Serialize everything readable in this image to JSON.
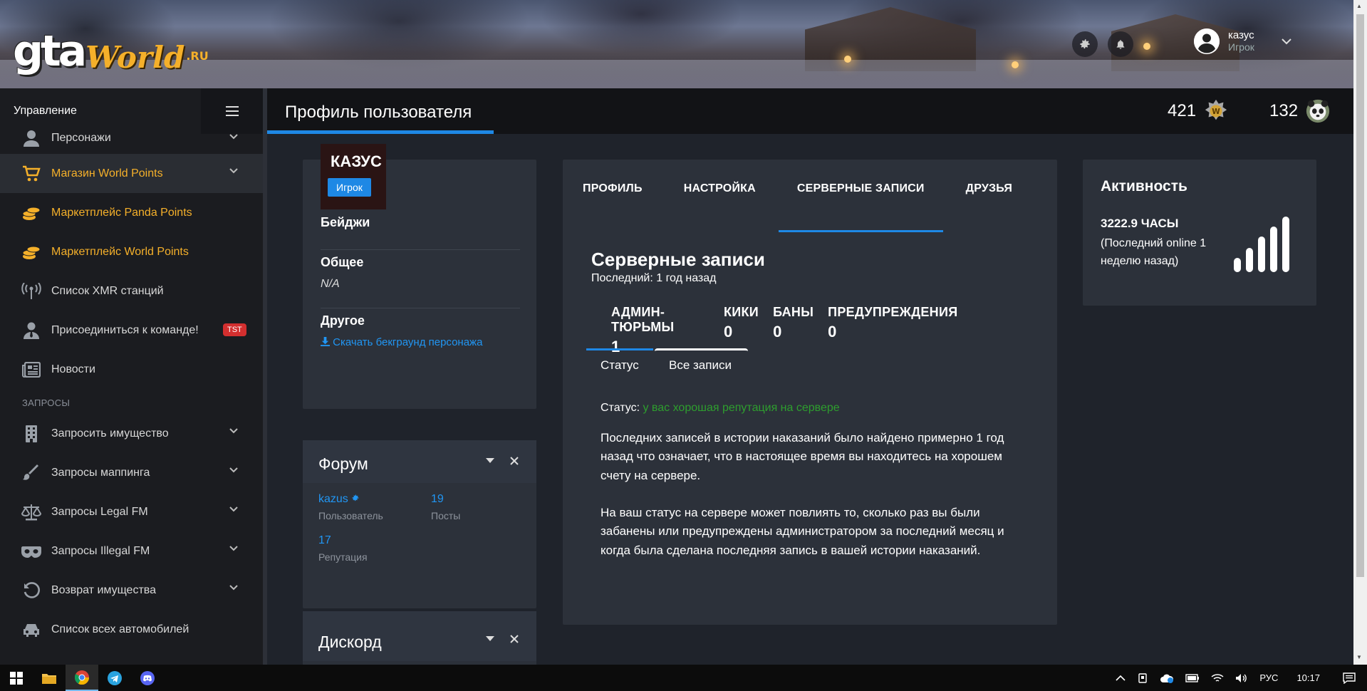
{
  "logo": {
    "part1": "gta",
    "part2": "World",
    "part3": ".RU"
  },
  "user": {
    "name": "казус",
    "role": "Игрок"
  },
  "sidebar": {
    "title": "Управление",
    "items": [
      {
        "label": "Персонажи",
        "icon": "person-icon",
        "gold": false,
        "dropdown": true
      },
      {
        "label": "Магазин World Points",
        "icon": "cart-icon",
        "gold": true,
        "dropdown": true,
        "active": true
      },
      {
        "label": "Маркетплейс Panda Points",
        "icon": "coins-icon",
        "gold": true
      },
      {
        "label": "Маркетплейс World Points",
        "icon": "coins-icon",
        "gold": true
      },
      {
        "label": "Список XMR станций",
        "icon": "antenna-icon"
      },
      {
        "label": "Присоединиться к команде!",
        "icon": "user-tie-icon",
        "badge": "TST"
      },
      {
        "label": "Новости",
        "icon": "newspaper-icon"
      }
    ],
    "section_label": "ЗАПРОСЫ",
    "requests": [
      {
        "label": "Запросить имущество",
        "icon": "building-icon"
      },
      {
        "label": "Запросы маппинга",
        "icon": "brush-icon"
      },
      {
        "label": "Запросы Legal FM",
        "icon": "scale-icon"
      },
      {
        "label": "Запросы Illegal FM",
        "icon": "mask-icon"
      },
      {
        "label": "Возврат имущества",
        "icon": "undo-icon"
      },
      {
        "label": "Список всех автомобилей",
        "icon": "car-icon"
      }
    ]
  },
  "header": {
    "title": "Профиль пользователя",
    "world_points": "421",
    "panda_points": "132"
  },
  "profile": {
    "name": "КАЗУС",
    "role": "Игрок",
    "badges_label": "Бейджи",
    "general_label": "Общее",
    "general_value": "N/A",
    "other_label": "Другое",
    "download_link": "Скачать бекграунд персонажа"
  },
  "forum": {
    "title": "Форум",
    "username": "kazus",
    "username_label": "Пользователь",
    "posts": "19",
    "posts_label": "Посты",
    "reputation": "17",
    "reputation_label": "Репутация"
  },
  "discord": {
    "title": "Дискорд"
  },
  "main": {
    "tabs": [
      "ПРОФИЛЬ",
      "НАСТРОЙКА",
      "СЕРВЕРНЫЕ ЗАПИСИ",
      "ДРУЗЬЯ"
    ],
    "title": "Серверные записи",
    "subtitle": "Последний: 1 год назад",
    "counters": [
      {
        "label": "АДМИН-ТЮРЬМЫ",
        "value": "1"
      },
      {
        "label": "КИКИ",
        "value": "0"
      },
      {
        "label": "БАНЫ",
        "value": "0"
      },
      {
        "label": "ПРЕДУПРЕЖДЕНИЯ",
        "value": "0"
      }
    ],
    "subtab_status": "Статус",
    "subtab_all": "Все записи",
    "status_prefix": "Статус:",
    "status_text": "у вас хорошая репутация на сервере",
    "para1": "Последних записей в истории наказаний было найдено примерно 1 год назад что означает, что в настоящее время вы находитесь на хорошем счету на сервере.",
    "para2": "На ваш статус на сервере может повлиять то, сколько раз вы были забанены или предупреждены администратором за последний месяц и когда была сделана последняя запись в вашей истории наказаний."
  },
  "activity": {
    "title": "Активность",
    "hours": "3222.9 ЧАСЫ",
    "last_online": "(Последний online 1 неделю назад)"
  },
  "taskbar": {
    "lang": "РУС",
    "time": "10:17"
  },
  "colors": {
    "accent": "#1e88e5",
    "gold": "#f5b02a",
    "good_status": "#2e9e2e",
    "badge_red": "#d32f2f"
  }
}
